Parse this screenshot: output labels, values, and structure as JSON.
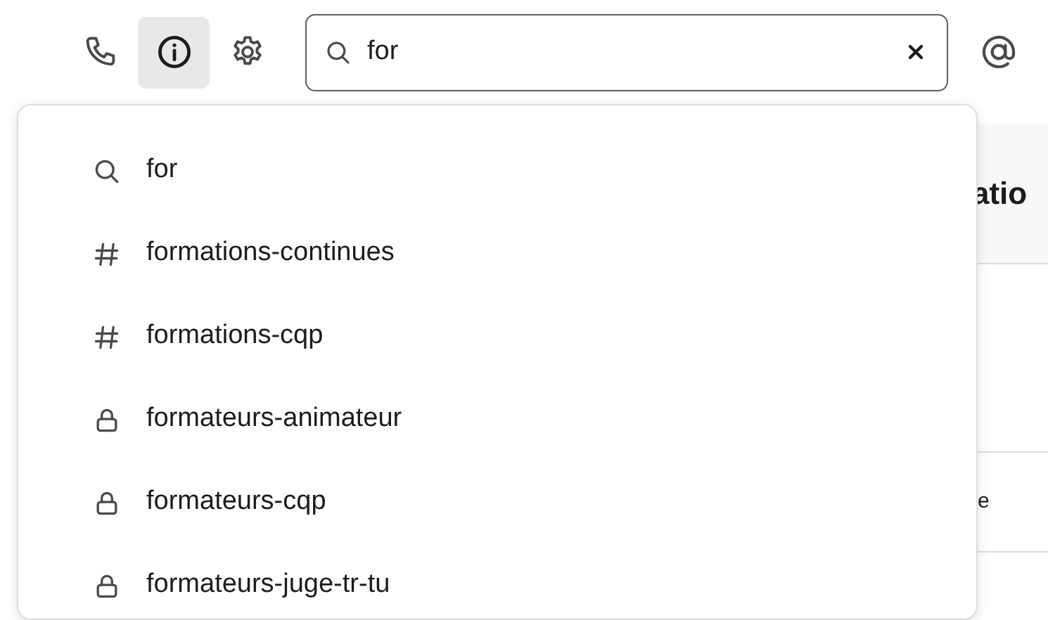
{
  "toolbar": {
    "buttons": [
      {
        "kind": "phone",
        "selected": false
      },
      {
        "kind": "info",
        "selected": true
      },
      {
        "kind": "gear",
        "selected": false
      }
    ]
  },
  "search": {
    "value": "for"
  },
  "suggestions": [
    {
      "kind": "search",
      "label": "for"
    },
    {
      "kind": "channel",
      "label": "formations-continues"
    },
    {
      "kind": "channel",
      "label": "formations-cqp"
    },
    {
      "kind": "private",
      "label": "formateurs-animateur"
    },
    {
      "kind": "private",
      "label": "formateurs-cqp"
    },
    {
      "kind": "private",
      "label": "formateurs-juge-tr-tu"
    }
  ],
  "background_panel": {
    "header": "atio",
    "cells": [
      "e"
    ]
  }
}
